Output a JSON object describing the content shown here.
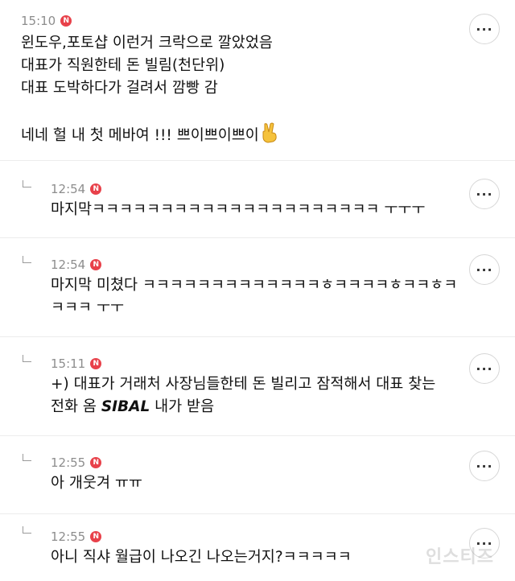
{
  "comments": [
    {
      "time": "15:10",
      "badge": "N",
      "lines": [
        "윈도우,포토샵 이런거 크락으로 깔았었음",
        "대표가 직원한테 돈 빌림(천단위)",
        "대표 도박하다가 걸려서 깜빵 감",
        "",
        "네네 헐 내 첫 메바여 !!! 쁘이쁘이쁘이"
      ],
      "emoji": "victory-hand-emoji"
    },
    {
      "time": "12:54",
      "badge": "N",
      "lines": [
        "마지막ㅋㅋㅋㅋㅋㅋㅋㅋㅋㅋㅋㅋㅋㅋㅋㅋㅋㅋㅋㅋㅋ ㅜㅜㅜ"
      ]
    },
    {
      "time": "12:54",
      "badge": "N",
      "lines": [
        "마지막 미쳤다 ㅋㅋㅋㅋㅋㅋㅋㅋㅋㅋㅋㅋㅋㅎㅋㅋㅋㅋㅎㅋㅋㅎㅋ",
        "ㅋㅋㅋ ㅜㅜ"
      ]
    },
    {
      "time": "15:11",
      "badge": "N",
      "lines": [
        "+) 대표가 거래처 사장님들한테 돈 빌리고 잠적해서 대표 찾는"
      ],
      "line2_prefix": "전화 옴 ",
      "line2_bold": "SIBAL",
      "line2_suffix": " 내가 받음"
    },
    {
      "time": "12:55",
      "badge": "N",
      "lines": [
        "아 개웃겨 ㅠㅠ"
      ]
    },
    {
      "time": "12:55",
      "badge": "N",
      "lines": [
        "아니 직샤 월급이 나오긴 나오는거지?ㅋㅋㅋㅋㅋ"
      ]
    }
  ],
  "more_button_label": "···",
  "watermark": "인스티즈"
}
